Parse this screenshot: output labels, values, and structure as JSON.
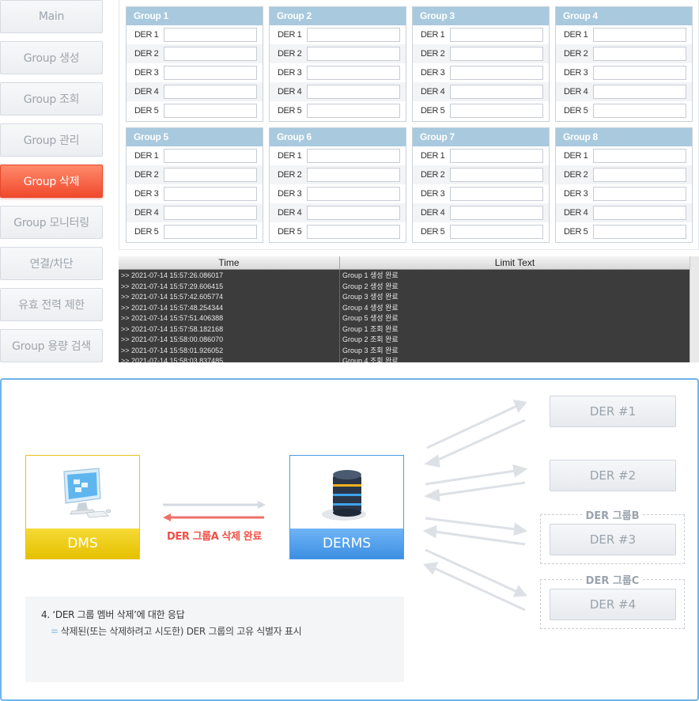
{
  "nav": {
    "items": [
      {
        "label": "Main",
        "active": false
      },
      {
        "label": "Group 생성",
        "active": false
      },
      {
        "label": "Group 조회",
        "active": false
      },
      {
        "label": "Group 관리",
        "active": false
      },
      {
        "label": "Group 삭제",
        "active": true
      },
      {
        "label": "Group 모니터링",
        "active": false
      },
      {
        "label": "연결/차단",
        "active": false
      },
      {
        "label": "유효 전력 제한",
        "active": false
      },
      {
        "label": "Group 용량 검색",
        "active": false
      }
    ],
    "colors": {
      "active": "#f0492c",
      "inactive_text": "#9ea5ae"
    }
  },
  "groups": [
    {
      "title": "Group 1",
      "ders": [
        "DER 1",
        "DER 2",
        "DER 3",
        "DER 4",
        "DER 5"
      ]
    },
    {
      "title": "Group 2",
      "ders": [
        "DER 1",
        "DER 2",
        "DER 3",
        "DER 4",
        "DER 5"
      ]
    },
    {
      "title": "Group 3",
      "ders": [
        "DER 1",
        "DER 2",
        "DER 3",
        "DER 4",
        "DER 5"
      ]
    },
    {
      "title": "Group 4",
      "ders": [
        "DER 1",
        "DER 2",
        "DER 3",
        "DER 4",
        "DER 5"
      ]
    },
    {
      "title": "Group 5",
      "ders": [
        "DER 1",
        "DER 2",
        "DER 3",
        "DER 4",
        "DER 5"
      ]
    },
    {
      "title": "Group 6",
      "ders": [
        "DER 1",
        "DER 2",
        "DER 3",
        "DER 4",
        "DER 5"
      ]
    },
    {
      "title": "Group 7",
      "ders": [
        "DER 1",
        "DER 2",
        "DER 3",
        "DER 4",
        "DER 5"
      ]
    },
    {
      "title": "Group 8",
      "ders": [
        "DER 1",
        "DER 2",
        "DER 3",
        "DER 4",
        "DER 5"
      ]
    }
  ],
  "log": {
    "columns": [
      "Time",
      "Limit Text"
    ],
    "rows": [
      {
        "time": ">> 2021-07-14 15:57:26.086017",
        "text": "Group 1 생성 완료"
      },
      {
        "time": ">> 2021-07-14 15:57:29.606415",
        "text": "Group 2 생성 완료"
      },
      {
        "time": ">> 2021-07-14 15:57:42.605774",
        "text": "Group 3 생성 완료"
      },
      {
        "time": ">> 2021-07-14 15:57:48.254344",
        "text": "Group 4 생성 완료"
      },
      {
        "time": ">> 2021-07-14 15:57:51.406388",
        "text": "Group 5 생성 완료"
      },
      {
        "time": ">> 2021-07-14 15:57:58.182168",
        "text": "Group 1 조회 완료"
      },
      {
        "time": ">> 2021-07-14 15:58:00.086070",
        "text": "Group 2 조회 완료"
      },
      {
        "time": ">> 2021-07-14 15:58:01.926052",
        "text": "Group 3 조회 완료"
      },
      {
        "time": ">> 2021-07-14 15:58:03.837485",
        "text": "Group 4 조회 완료"
      }
    ],
    "colors": {
      "background": "#3c3c3c",
      "text": "#e6e6e6"
    }
  },
  "diagram": {
    "dms_label": "DMS",
    "derms_label": "DERMS",
    "flow_text": "DER 그룹A 삭제 완료",
    "der_nodes": [
      "DER #1",
      "DER #2",
      "DER #3",
      "DER #4"
    ],
    "group_b_label": "DER 그룹B",
    "group_c_label": "DER 그룹C",
    "note_title": "4. ‘DER 그룹 멤버 삭제’에 대한 응답",
    "note_bullet": "삭제된(또는 삭제하려고 시도한) DER 그룹의 고유 식별자 표시",
    "bullet_symbol": "=",
    "colors": {
      "dms": "#e5c100",
      "derms": "#3d8fe3",
      "flow_text": "#ef4f46",
      "frame": "#6fb3e8"
    }
  }
}
